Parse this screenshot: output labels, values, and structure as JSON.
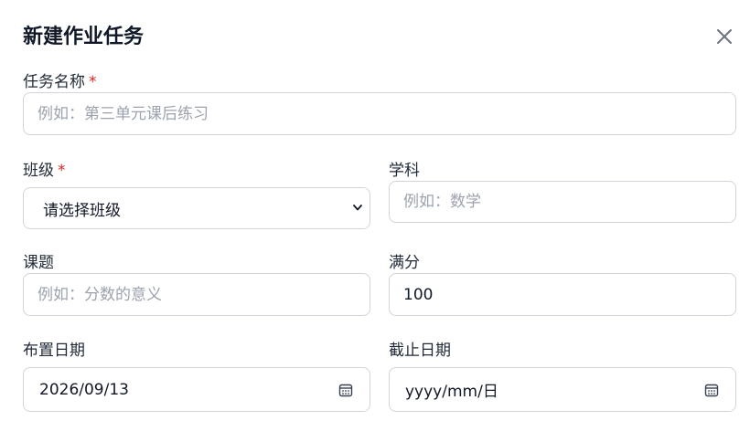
{
  "dialog": {
    "title": "新建作业任务",
    "close_icon": "close-icon"
  },
  "form": {
    "task_name": {
      "label": "任务名称",
      "required_mark": "*",
      "placeholder": "例如：第三单元课后练习"
    },
    "class": {
      "label": "班级",
      "required_mark": "*",
      "selected": "请选择班级",
      "icon": "chevron-down-icon"
    },
    "subject": {
      "label": "学科",
      "placeholder": "例如：数学"
    },
    "topic": {
      "label": "课题",
      "placeholder": "例如：分数的意义"
    },
    "full_score": {
      "label": "满分",
      "value": "100"
    },
    "assign_date": {
      "label": "布置日期",
      "value": "2026/09/13",
      "icon": "calendar-icon"
    },
    "due_date": {
      "label": "截止日期",
      "value": "yyyy/mm/日",
      "icon": "calendar-icon"
    }
  },
  "colors": {
    "required": "#dc2626",
    "border": "#d1d5db",
    "placeholder": "#9ca3af",
    "text": "#111827"
  }
}
